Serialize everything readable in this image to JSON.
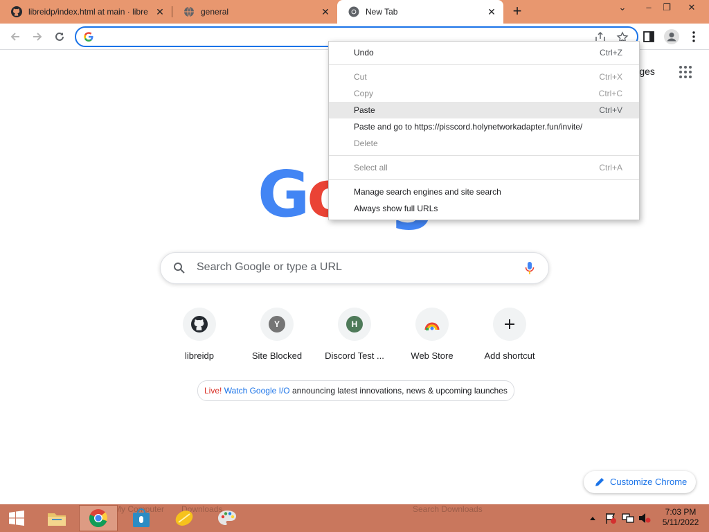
{
  "tabs": [
    {
      "title": "libreidp/index.html at main · libre",
      "icon": "github-icon"
    },
    {
      "title": "general",
      "icon": "globe-icon"
    },
    {
      "title": "New Tab",
      "icon": "chrome-icon"
    }
  ],
  "omnibox": {
    "value": "",
    "placeholder": ""
  },
  "page": {
    "images_link": "Images",
    "search_placeholder": "Search Google or type a URL",
    "shortcuts": [
      {
        "label": "libreidp",
        "icon": "github-icon"
      },
      {
        "label": "Site Blocked",
        "letter": "Y",
        "color": "#757575"
      },
      {
        "label": "Discord Test ...",
        "letter": "H",
        "color": "#4e7a59"
      },
      {
        "label": "Web Store",
        "icon": "webstore-icon"
      },
      {
        "label": "Add shortcut",
        "icon": "plus-icon"
      }
    ],
    "promo": {
      "live": "Live!",
      "link": "Watch Google I/O",
      "text": "announcing latest innovations, news & upcoming launches"
    },
    "customize_label": "Customize Chrome"
  },
  "context_menu": {
    "items": [
      {
        "label": "Undo",
        "shortcut": "Ctrl+Z",
        "enabled": true
      },
      {
        "label": "Cut",
        "shortcut": "Ctrl+X",
        "enabled": false
      },
      {
        "label": "Copy",
        "shortcut": "Ctrl+C",
        "enabled": false
      },
      {
        "label": "Paste",
        "shortcut": "Ctrl+V",
        "enabled": true,
        "hovered": true
      },
      {
        "label": "Paste and go to https://pisscord.holynetworkadapter.fun/invite/",
        "shortcut": "",
        "enabled": true
      },
      {
        "label": "Delete",
        "shortcut": "",
        "enabled": false
      },
      {
        "label": "Select all",
        "shortcut": "Ctrl+A",
        "enabled": false
      },
      {
        "label": "Manage search engines and site search",
        "shortcut": "",
        "enabled": true
      },
      {
        "label": "Always show full URLs",
        "shortcut": "",
        "enabled": true
      }
    ]
  },
  "taskbar": {
    "ghost_text": [
      "My Computer",
      "Downloads",
      "Search Downloads"
    ],
    "clock_time": "7:03 PM",
    "clock_date": "5/11/2022"
  },
  "colors": {
    "tabstrip": "#e8976f",
    "taskbar": "#c9775d",
    "accent": "#1a73e8"
  }
}
